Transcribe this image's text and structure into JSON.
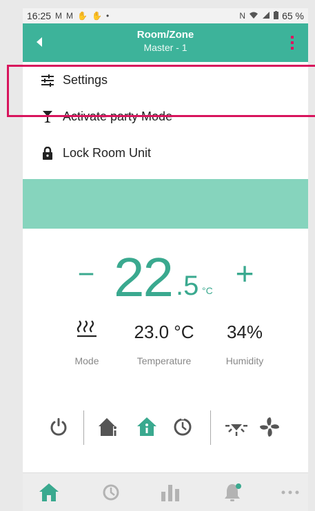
{
  "status_bar": {
    "time": "16:25",
    "notification_icons": [
      "gmail-icon",
      "gmail-icon",
      "touch-icon",
      "touch-icon",
      "dot-icon"
    ],
    "battery": "65 %"
  },
  "app_bar": {
    "title": "Room/Zone",
    "subtitle": "Master - 1",
    "accent": "#3db39a",
    "menu_dots_color": "#e0115f"
  },
  "menu": {
    "items": [
      {
        "label": "Settings",
        "icon": "sliders-icon"
      },
      {
        "label": "Activate party Mode",
        "icon": "cocktail-icon"
      },
      {
        "label": "Lock Room Unit",
        "icon": "lock-icon"
      }
    ]
  },
  "thermostat": {
    "minus": "−",
    "integer": "22",
    "decimal": ".5",
    "unit": "°C",
    "plus": "+"
  },
  "stats": {
    "mode": {
      "value_icon": "heating-icon",
      "label": "Mode"
    },
    "temperature": {
      "value": "23.0 °C",
      "label": "Temperature"
    },
    "humidity": {
      "value": "34%",
      "label": "Humidity"
    }
  },
  "controls": [
    "power-icon",
    "home-info-icon",
    "home-active-icon",
    "timer-icon",
    "light-icon",
    "fan-icon"
  ],
  "bottom_nav": [
    "home-icon",
    "timer-icon",
    "stats-icon",
    "bell-icon",
    "more-icon"
  ],
  "colors": {
    "teal": "#3aa98f",
    "banner": "#86d4bd",
    "highlight": "#d8145c"
  }
}
